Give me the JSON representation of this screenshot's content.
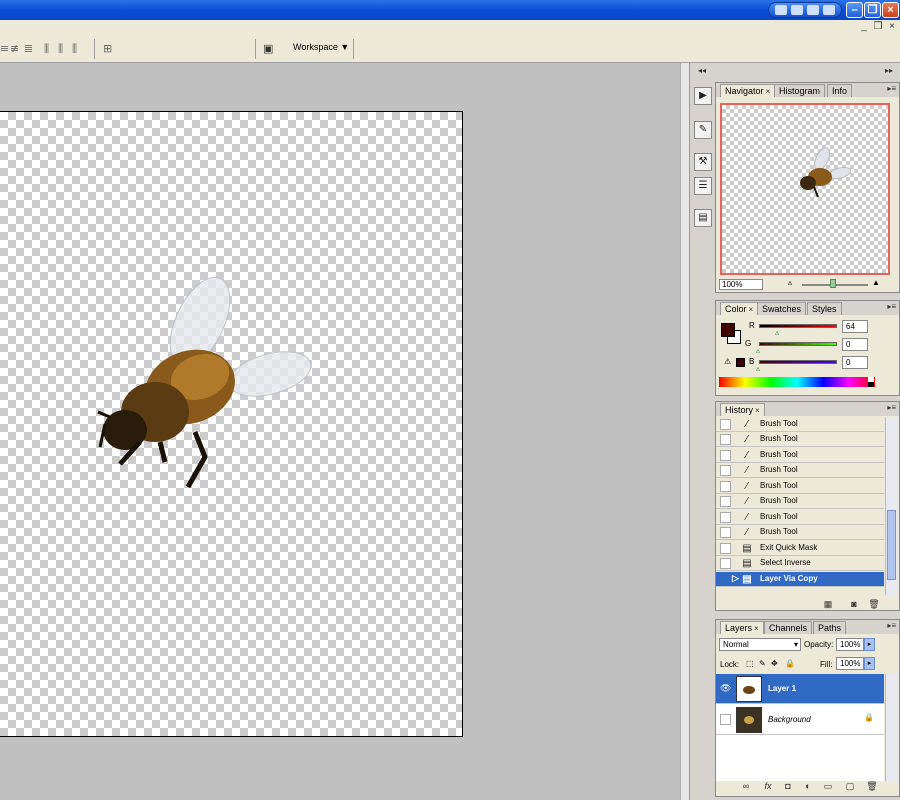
{
  "menu_toolbar": {
    "icons": [
      "align-top-icon",
      "align-vcenter-icon",
      "align-bottom-icon",
      "distribute-left-icon",
      "distribute-hcenter-icon",
      "distribute-right-icon",
      "auto-align-icon"
    ],
    "workspace_label": "Workspace"
  },
  "panels": {
    "navigator": {
      "tabs": [
        "Navigator",
        "Histogram",
        "Info"
      ],
      "zoom": "100%"
    },
    "color": {
      "tabs": [
        "Color",
        "Swatches",
        "Styles"
      ],
      "channels": [
        {
          "label": "R",
          "value": "64",
          "slider": 0.25
        },
        {
          "label": "G",
          "value": "0",
          "slider": 0.0
        },
        {
          "label": "B",
          "value": "0",
          "slider": 0.0
        }
      ],
      "foreground": "#400000",
      "background": "#ffffff"
    },
    "history": {
      "tabs": [
        "History"
      ],
      "items": [
        {
          "label": "Brush Tool",
          "icon": "brush-icon"
        },
        {
          "label": "Brush Tool",
          "icon": "brush-icon"
        },
        {
          "label": "Brush Tool",
          "icon": "brush-icon"
        },
        {
          "label": "Brush Tool",
          "icon": "brush-icon"
        },
        {
          "label": "Brush Tool",
          "icon": "brush-icon"
        },
        {
          "label": "Brush Tool",
          "icon": "brush-icon"
        },
        {
          "label": "Brush Tool",
          "icon": "brush-icon"
        },
        {
          "label": "Brush Tool",
          "icon": "brush-icon"
        },
        {
          "label": "Exit Quick Mask",
          "icon": "history-state-icon"
        },
        {
          "label": "Select Inverse",
          "icon": "history-state-icon"
        },
        {
          "label": "Layer Via Copy",
          "icon": "history-state-icon",
          "selected": true
        }
      ]
    },
    "layers": {
      "tabs": [
        "Layers",
        "Channels",
        "Paths"
      ],
      "blend_mode": "Normal",
      "opacity_label": "Opacity:",
      "opacity": "100%",
      "lock_label": "Lock:",
      "fill_label": "Fill:",
      "fill": "100%",
      "items": [
        {
          "name": "Layer 1",
          "visible": true,
          "selected": true
        },
        {
          "name": "Background",
          "visible": false,
          "selected": false,
          "locked": true
        }
      ]
    }
  },
  "dock_icons": [
    "play-icon",
    "brush-preset-icon",
    "tool-preset-icon",
    "layer-comps-icon",
    "info-icon"
  ],
  "colors": {
    "selection": "#316ac5",
    "navigator_frame": "#e8645a"
  }
}
